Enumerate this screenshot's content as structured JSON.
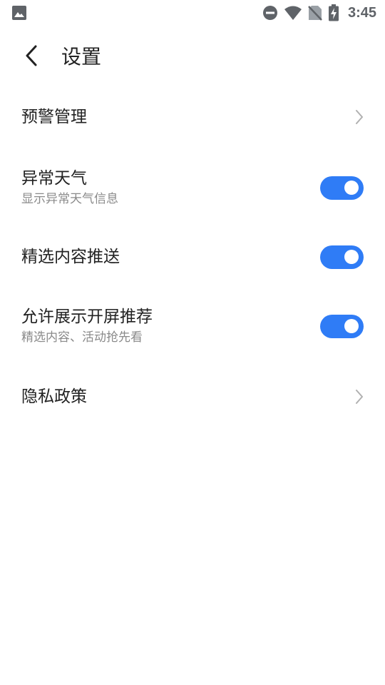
{
  "status_bar": {
    "time": "3:45",
    "icons": [
      "image-icon",
      "do-not-disturb-icon",
      "wifi-icon",
      "no-sim-icon",
      "battery-charging-icon"
    ]
  },
  "header": {
    "title": "设置",
    "back_icon": "back-arrow-icon"
  },
  "settings": {
    "items": [
      {
        "title": "预警管理",
        "subtitle": "",
        "control": "chevron"
      },
      {
        "title": "异常天气",
        "subtitle": "显示异常天气信息",
        "control": "toggle",
        "on": true
      },
      {
        "title": "精选内容推送",
        "subtitle": "",
        "control": "toggle",
        "on": true
      },
      {
        "title": "允许展示开屏推荐",
        "subtitle": "精选内容、活动抢先看",
        "control": "toggle",
        "on": true
      },
      {
        "title": "隐私政策",
        "subtitle": "",
        "control": "chevron"
      }
    ]
  },
  "colors": {
    "accent": "#2f7cf6",
    "text_primary": "#222222",
    "text_secondary": "#8a8a8a",
    "chevron": "#b0b0b0",
    "status_icons": "#5f6368"
  }
}
